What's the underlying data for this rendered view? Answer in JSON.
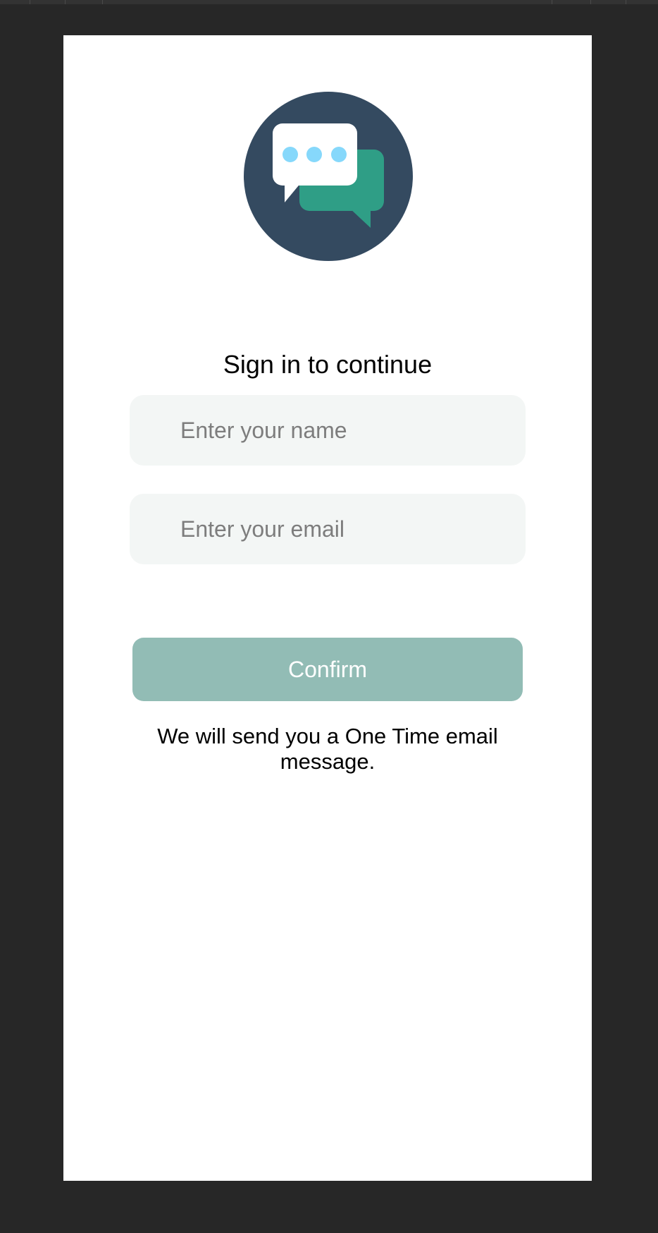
{
  "logo": {
    "icon": "chat-bubbles-icon",
    "circle_color": "#344a60",
    "front_bubble_color": "#ffffff",
    "back_bubble_color": "#2f9e86",
    "dots_color": "#86d8fb"
  },
  "signin": {
    "title": "Sign in to continue",
    "name_placeholder": "Enter your name",
    "name_value": "",
    "email_placeholder": "Enter your email",
    "email_value": "",
    "confirm_label": "Confirm",
    "confirm_color": "#92bcb5",
    "note": "We will send you a One Time email message."
  }
}
